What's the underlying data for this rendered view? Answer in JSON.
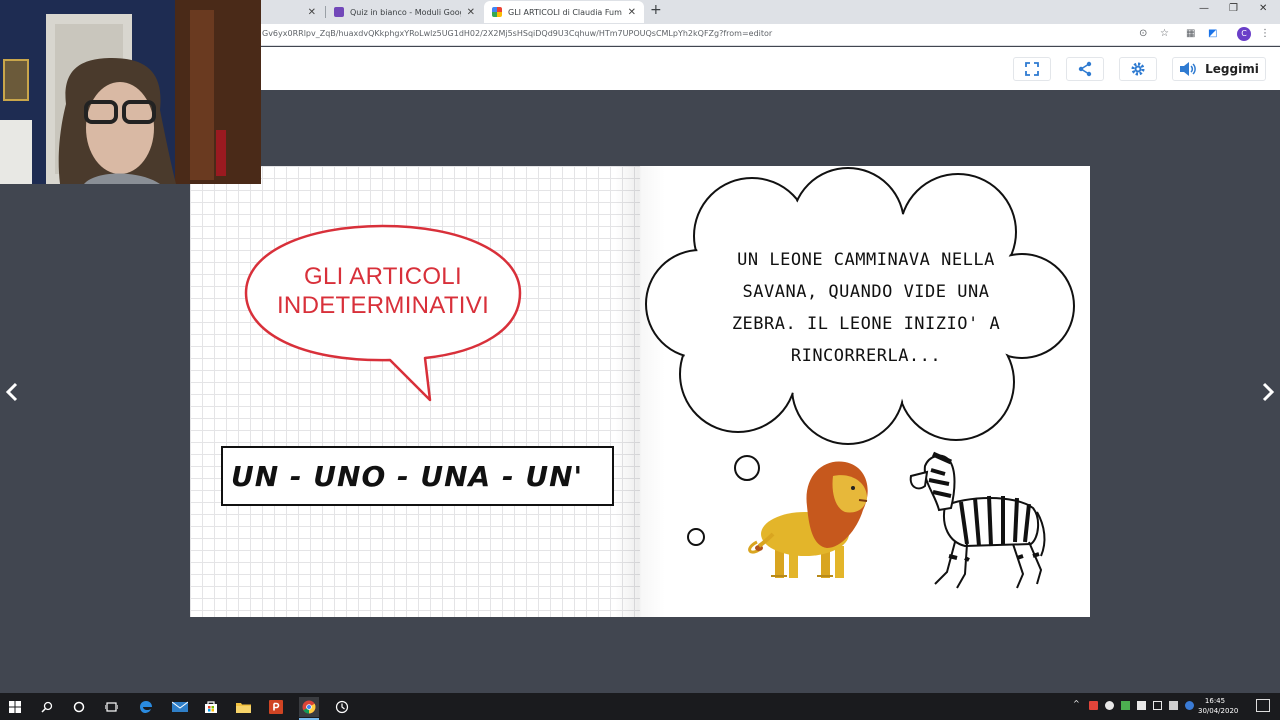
{
  "browser": {
    "tabs": [
      {
        "label": "",
        "active": false
      },
      {
        "label": "Quiz in bianco - Moduli Google",
        "active": false
      },
      {
        "label": "GLI ARTICOLI di Claudia Fumagalli",
        "active": true
      }
    ],
    "url": "Gv6yx0RRlpv_ZqB/huaxdvQKkphgxYRoLwlz5UG1dH02/2X2Mj5sHSqiDQd9U3Cqhuw/HTm7UPOUQsCMLpYh2kQFZg?from=editor",
    "profile_initial": "C"
  },
  "toolbar": {
    "read_label": "Leggimi",
    "icons": [
      "fullscreen-icon",
      "share-icon",
      "gear-icon",
      "speaker-icon"
    ]
  },
  "book": {
    "left_page": {
      "title_lines": [
        "GLI ARTICOLI",
        "INDETERMINATIVI"
      ],
      "articles": "UN - UNO - UNA - UN'"
    },
    "right_page": {
      "story_lines": [
        "UN LEONE CAMMINAVA NELLA",
        "SAVANA, QUANDO VIDE UNA",
        "ZEBRA. IL LEONE INIZIO' A",
        "RINCORRERLA..."
      ]
    }
  },
  "taskbar": {
    "time": "16:45",
    "date": "30/04/2020"
  },
  "colors": {
    "title_red": "#d8303a",
    "background": "#414650",
    "taskbar": "#1a1b1e"
  }
}
